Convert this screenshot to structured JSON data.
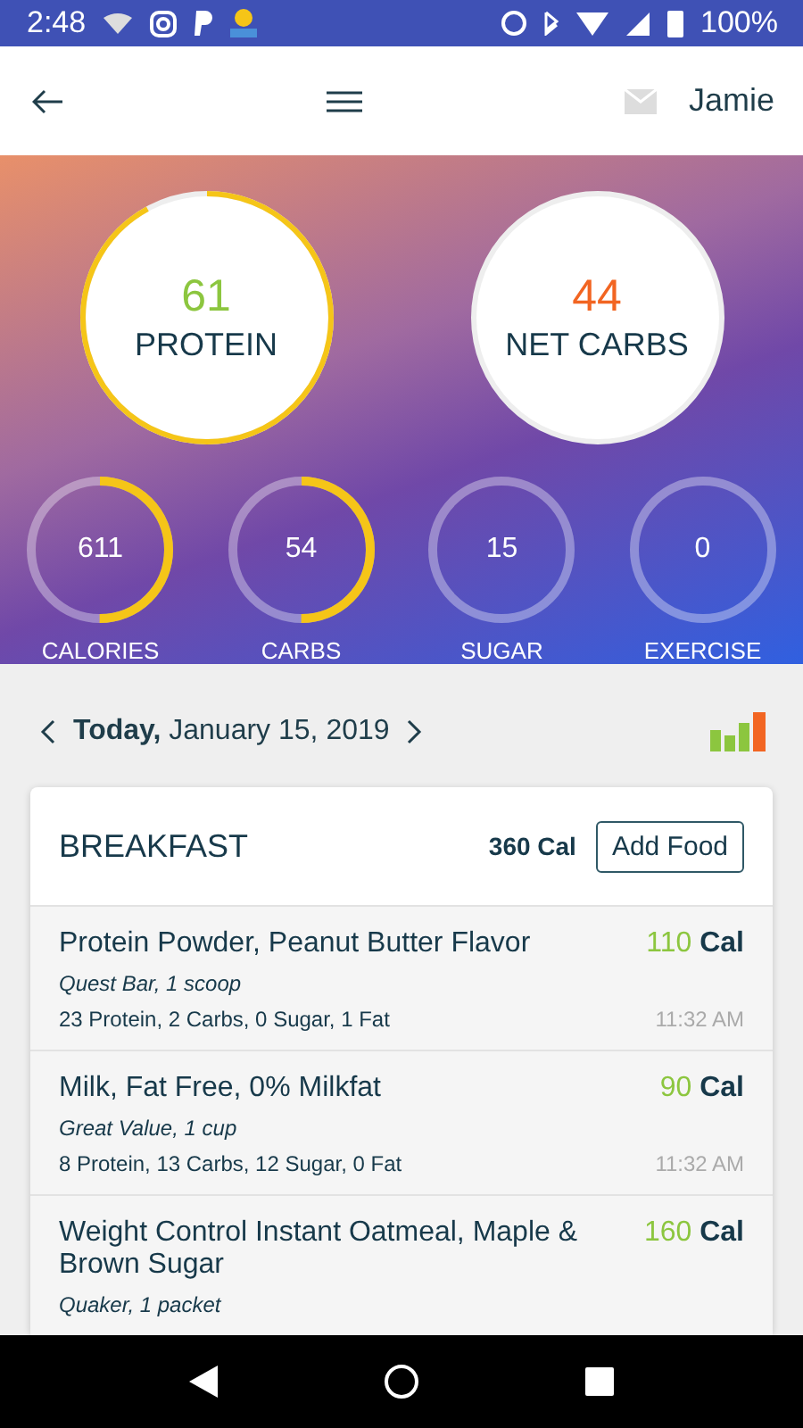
{
  "status_bar": {
    "time": "2:48",
    "battery": "100%"
  },
  "header": {
    "user": "Jamie"
  },
  "big_rings": [
    {
      "value": "61",
      "label": "PROTEIN",
      "color": "#8cc63f"
    },
    {
      "value": "44",
      "label": "NET CARBS",
      "color": "#f26522"
    }
  ],
  "small_rings": [
    {
      "value": "611",
      "label": "CALORIES"
    },
    {
      "value": "54",
      "label": "CARBS"
    },
    {
      "value": "15",
      "label": "SUGAR"
    },
    {
      "value": "0",
      "label": "EXERCISE"
    }
  ],
  "date": "**Today,** January 15, 2019",
  "meal": {
    "title": "BREAKFAST",
    "total": "360 Cal",
    "button": "Add Food",
    "items": [
      {
        "name": "Protein Powder, Peanut Butter Flavor",
        "calories": "110",
        "unit": "Cal",
        "serving": "Quest Bar, 1 scoop",
        "macros": "23 Protein, 2 Carbs, 0 Sugar, 1 Fat",
        "time": "11:32 AM"
      },
      {
        "name": "Milk, Fat Free, 0% Milkfat",
        "calories": "90",
        "unit": "Cal",
        "serving": "Great Value, 1 cup",
        "macros": "8 Protein, 13 Carbs, 12 Sugar, 0 Fat",
        "time": "11:32 AM"
      },
      {
        "name": "Weight Control Instant Oatmeal, Maple & Brown Sugar",
        "calories": "160",
        "unit": "Cal",
        "serving": "Quaker, 1 packet"
      }
    ]
  }
}
